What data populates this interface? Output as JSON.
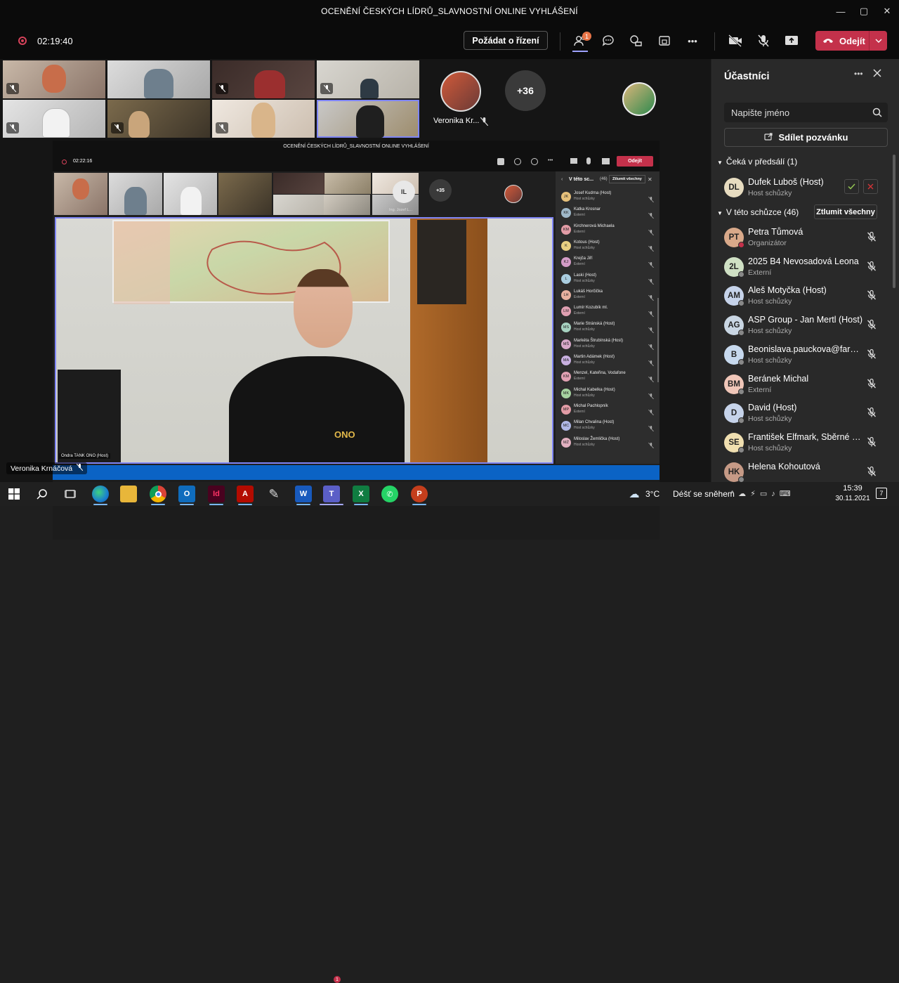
{
  "window": {
    "title": "OCENĚNÍ ČESKÝCH LÍDRŮ_SLAVNOSTNÍ ONLINE VYHLÁŠENÍ",
    "minimize": "—",
    "maximize": "▢",
    "close": "✕"
  },
  "toolbar": {
    "timer": "02:19:40",
    "request_control_label": "Požádat o řízení",
    "people_badge": "1",
    "more_label": "•••",
    "leave_label": "Odejít"
  },
  "tiles": {
    "featured_name": "Veronika Kr...",
    "overflow_count": "+36",
    "presenter_name": "Veronika Krnáčová"
  },
  "shared_screen": {
    "title": "OCENĚNÍ ČESKÝCH LÍDRŮ_SLAVNOSTNÍ ONLINE VYHLÁŠENÍ",
    "timer": "02:22:16",
    "leave_label": "Odejít",
    "il_initials": "IL",
    "il_name": "Ing. Jozef L...",
    "overflow_count": "+35",
    "panel_title": "V této sc...",
    "panel_count": "(46)",
    "mute_all": "Ztlumit všechny",
    "video_caption": "Ondra TANK ONO (Host)",
    "shirt_logo": "ONO",
    "rows": [
      {
        "name": "Josef Kudrna (Host)",
        "role": "Host schůzky",
        "init": "JK",
        "color": "#e6c07a"
      },
      {
        "name": "Katka Krosnar",
        "role": "Externí",
        "init": "KK",
        "color": "#9fb8c9"
      },
      {
        "name": "Kirchnerová Michaela",
        "role": "Externí",
        "init": "KM",
        "color": "#e29ca6"
      },
      {
        "name": "Kotous (Host)",
        "role": "Host schůzky",
        "init": "K",
        "color": "#e8cf82"
      },
      {
        "name": "Krejča Jiří",
        "role": "Externí",
        "init": "KJ",
        "color": "#d49cc7"
      },
      {
        "name": "Laski (Host)",
        "role": "Host schůzky",
        "init": "L",
        "color": "#a9cde0"
      },
      {
        "name": "Lukáš Horčička",
        "role": "Externí",
        "init": "LH",
        "color": "#e8b1a0"
      },
      {
        "name": "Lumír Kozubík ml.",
        "role": "Externí",
        "init": "LM",
        "color": "#e0a0b2"
      },
      {
        "name": "Marie Stránská (Host)",
        "role": "Host schůzky",
        "init": "MS",
        "color": "#a6d2c0"
      },
      {
        "name": "Markéta Štrubínská (Host)",
        "role": "Host schůzky",
        "init": "MŠ",
        "color": "#d8a8c9"
      },
      {
        "name": "Martin Adámek (Host)",
        "role": "Host schůzky",
        "init": "MA",
        "color": "#c8b0e0"
      },
      {
        "name": "Menzel, Kateřina, Vodafone",
        "role": "Externí",
        "init": "KM",
        "color": "#e0a0b2"
      },
      {
        "name": "Michal Kabelka (Host)",
        "role": "Host schůzky",
        "init": "MK",
        "color": "#a6d2a0"
      },
      {
        "name": "Michal Pachlopník",
        "role": "Externí",
        "init": "MP",
        "color": "#e29ca6"
      },
      {
        "name": "Milan Chvalina (Host)",
        "role": "Host schůzky",
        "init": "MC",
        "color": "#b0b8e6"
      },
      {
        "name": "Miloslav Žemlička (Host)",
        "role": "Host schůzky",
        "init": "MŽ",
        "color": "#e2b0c0"
      }
    ]
  },
  "sidebar": {
    "title": "Účastníci",
    "more": "•••",
    "search_placeholder": "Napište jméno",
    "invite_label": "Sdílet pozvánku",
    "lobby_header": "Čeká v předsálí (1)",
    "lobby": {
      "name": "Dufek Luboš (Host)",
      "role": "Host schůzky",
      "init": "DL",
      "color": "#e7dcc0"
    },
    "meeting_header": "V této schůzce (46)",
    "mute_all_label": "Ztlumit všechny",
    "participants": [
      {
        "name": "Petra Tůmová",
        "role": "Organizátor",
        "init": "PT",
        "color": "#d9a98a",
        "status": "#c4314b"
      },
      {
        "name": "2025 B4 Nevosadová Leona",
        "role": "Externí",
        "init": "2L",
        "color": "#cfe0c4",
        "status": "#888"
      },
      {
        "name": "Aleš Motyčka (Host)",
        "role": "Host schůzky",
        "init": "AM",
        "color": "#c6d3ea",
        "status": "#888"
      },
      {
        "name": "ASP Group - Jan Mertl (Host)",
        "role": "Host schůzky",
        "init": "AG",
        "color": "#c9d6e3",
        "status": "#888"
      },
      {
        "name": "Beonislava.pauckova@farmak...",
        "role": "Host schůzky",
        "init": "B",
        "color": "#c7d9ee",
        "status": "#888"
      },
      {
        "name": "Beránek Michal",
        "role": "Externí",
        "init": "BM",
        "color": "#f0c6b8",
        "status": "#888"
      },
      {
        "name": "David (Host)",
        "role": "Host schůzky",
        "init": "D",
        "color": "#c6d3ea",
        "status": "#888"
      },
      {
        "name": "František Elfmark, Sběrné sur...",
        "role": "Host schůzky",
        "init": "SE",
        "color": "#f0dfb0",
        "status": "#888"
      },
      {
        "name": "Helena Kohoutová",
        "role": "",
        "init": "HK",
        "color": "#c69a86",
        "status": "#888"
      }
    ]
  },
  "taskbar": {
    "weather_temp": "3°C",
    "weather_text": "Déšť se sněhem",
    "time": "15:39",
    "date": "30.11.2021",
    "notif_count": "7",
    "teams_badge": "1",
    "indesign_label": "Id"
  }
}
